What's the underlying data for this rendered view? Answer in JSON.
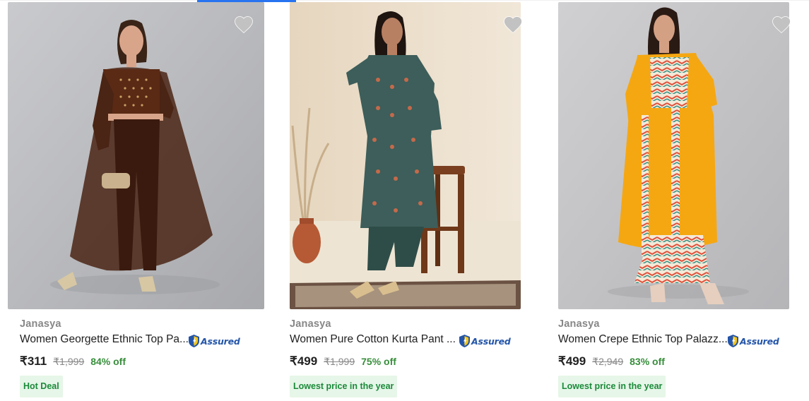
{
  "products": [
    {
      "brand": "Janasya",
      "title": "Women Georgette Ethnic Top Pa...",
      "assured": "Assured",
      "price": "₹311",
      "mrp": "₹1,999",
      "discount": "84% off",
      "deal": "Hot Deal",
      "wishlist_icon": "heart-icon"
    },
    {
      "brand": "Janasya",
      "title": "Women Pure Cotton Kurta Pant ...",
      "assured": "Assured",
      "price": "₹499",
      "mrp": "₹1,999",
      "discount": "75% off",
      "deal": "Lowest price in the year",
      "wishlist_icon": "heart-icon"
    },
    {
      "brand": "Janasya",
      "title": "Women Crepe Ethnic Top Palazz...",
      "assured": "Assured",
      "price": "₹499",
      "mrp": "₹2,949",
      "discount": "83% off",
      "deal": "Lowest price in the year",
      "wishlist_icon": "heart-icon"
    }
  ],
  "colors": {
    "brand_text": "#878787",
    "discount_green": "#388e3c",
    "deal_background": "#e6f6e8",
    "assured_blue": "#2455a8",
    "wishlist_heart": "#c2c2c2"
  }
}
